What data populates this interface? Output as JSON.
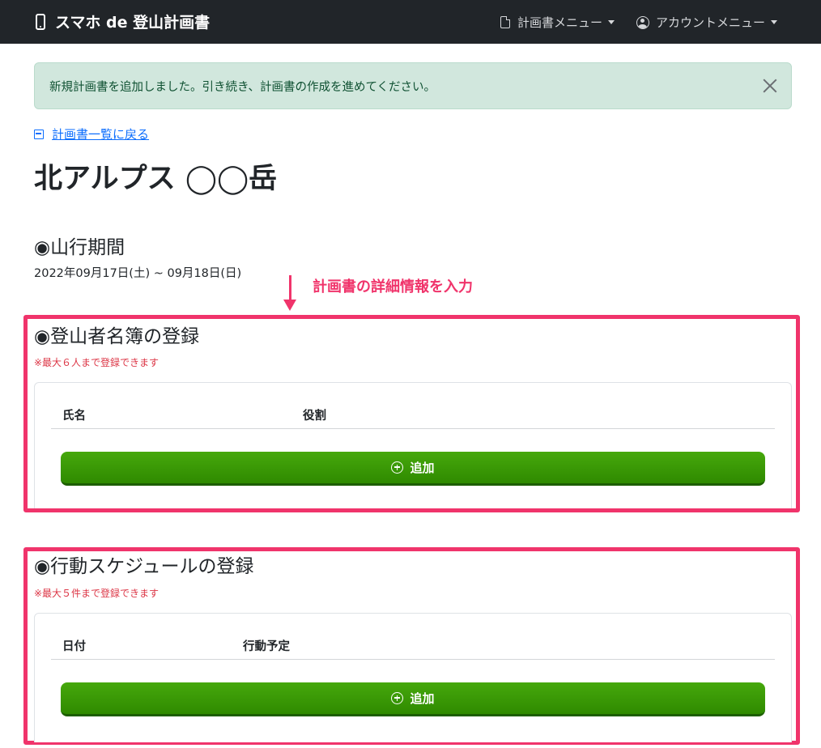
{
  "navbar": {
    "brand": "スマホ de 登山計画書",
    "plan_menu": "計画書メニュー",
    "account_menu": "アカウントメニュー"
  },
  "alert": {
    "message": "新規計画書を追加しました。引き続き、計画書の作成を進めてください。"
  },
  "back_link": "計画書一覧に戻る",
  "plan_title": "北アルプス ◯◯岳",
  "period": {
    "heading": "◉山行期間",
    "dates": "2022年09月17日(土) ~ 09月18日(日)"
  },
  "annotation": {
    "label": "計画書の詳細情報を入力",
    "color": "#f0346b"
  },
  "members": {
    "heading": "◉登山者名簿の登録",
    "note": "※最大６人まで登録できます",
    "columns": [
      "氏名",
      "役割"
    ],
    "add_label": "追加"
  },
  "schedule": {
    "heading": "◉行動スケジュールの登録",
    "note": "※最大５件まで登録できます",
    "columns": [
      "日付",
      "行動予定"
    ],
    "add_label": "追加"
  },
  "colors": {
    "navbar_bg": "#212529",
    "alert_bg": "#d1e7dd",
    "link": "#0d6efd",
    "note_red": "#dc3545",
    "button_green": "#3a9a06"
  },
  "icons": {
    "brand": "phone-icon",
    "plan_menu": "document-icon",
    "account_menu": "user-circle-icon",
    "back": "box-arrow-left-icon",
    "add": "plus-circle-icon",
    "close": "close-icon"
  }
}
